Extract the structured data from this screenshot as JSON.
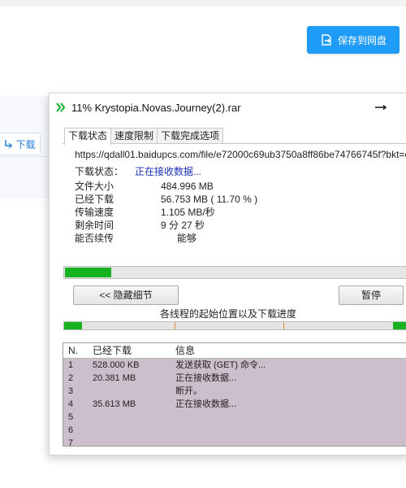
{
  "page": {
    "save_button_label": "保存到网盘",
    "side_download_label": "下载"
  },
  "dialog": {
    "title": "11% Krystopia.Novas.Journey(2).rar",
    "tabs": [
      {
        "label": "下载状态"
      },
      {
        "label": "速度限制"
      },
      {
        "label": "下载完成选项"
      }
    ],
    "url": "https://qdall01.baidupcs.com/file/e72000c69ub3750a8ff86be74766745f?bkt=e",
    "status_label": "下载状态：",
    "status_value": "正在接收数据...",
    "info": [
      {
        "label": "文件大小",
        "value": "484.996  MB"
      },
      {
        "label": "已经下载",
        "value": "56.753  MB  ( 11.70 % )"
      },
      {
        "label": "传输速度",
        "value": "1.105  MB/秒"
      },
      {
        "label": "剩余时间",
        "value": "9 分 27 秒"
      },
      {
        "label": "能否续传",
        "value": "      能够"
      }
    ],
    "progress_fraction": 0.117,
    "hide_details_label": "<< 隐藏细节",
    "pause_label": "暂停",
    "threads_caption": "各线程的起始位置以及下载进度",
    "table": {
      "columns": [
        "N.",
        "已经下载",
        "信息"
      ],
      "rows": [
        {
          "n": "1",
          "downloaded": "528.000  KB",
          "info": "发送获取 (GET) 命令..."
        },
        {
          "n": "2",
          "downloaded": "20.381  MB",
          "info": "正在接收数据..."
        },
        {
          "n": "3",
          "downloaded": "",
          "info": "断开。"
        },
        {
          "n": "4",
          "downloaded": "35.613  MB",
          "info": "正在接收数据..."
        },
        {
          "n": "5",
          "downloaded": "",
          "info": ""
        },
        {
          "n": "6",
          "downloaded": "",
          "info": ""
        },
        {
          "n": "7",
          "downloaded": "",
          "info": ""
        }
      ]
    }
  },
  "colors": {
    "accent_blue": "#1e9cf7",
    "progress_green": "#17b21f",
    "status_blue": "#1a2fb5",
    "table_bg": "#cdbecb"
  }
}
